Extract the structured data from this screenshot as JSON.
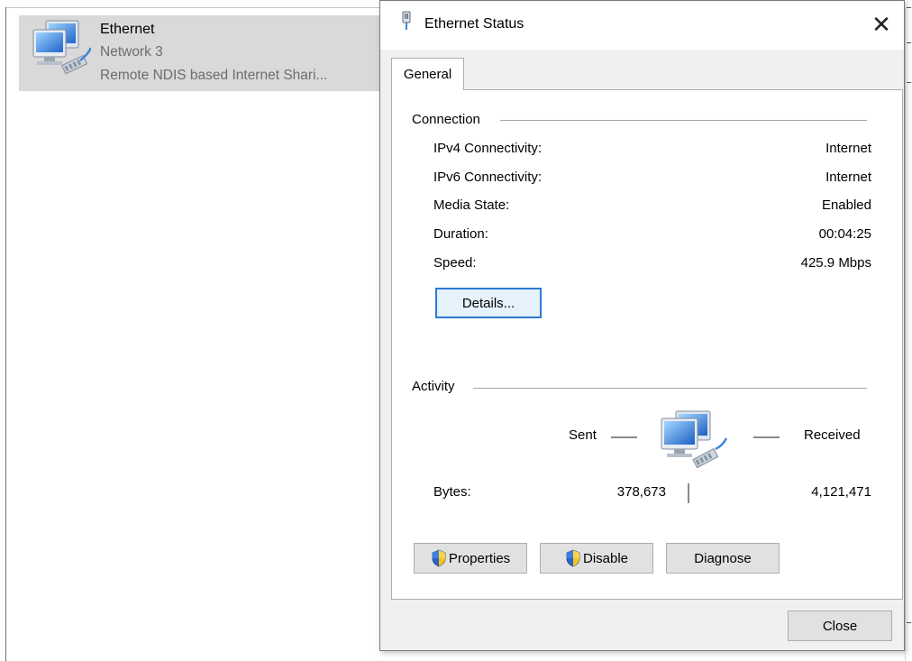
{
  "background_window": {
    "adapter": {
      "name": "Ethernet",
      "network": "Network 3",
      "device": "Remote NDIS based Internet Shari...",
      "icon": "network-adapter-icon"
    }
  },
  "dialog": {
    "title": "Ethernet Status",
    "close_glyph": "✕",
    "tabs": [
      "General"
    ],
    "connection": {
      "label": "Connection",
      "rows": [
        {
          "label": "IPv4 Connectivity:",
          "value": "Internet"
        },
        {
          "label": "IPv6 Connectivity:",
          "value": "Internet"
        },
        {
          "label": "Media State:",
          "value": "Enabled"
        },
        {
          "label": "Duration:",
          "value": "00:04:25"
        },
        {
          "label": "Speed:",
          "value": "425.9 Mbps"
        }
      ],
      "details_button": "Details..."
    },
    "activity": {
      "label": "Activity",
      "sent_label": "Sent",
      "received_label": "Received",
      "bytes_label": "Bytes:",
      "bytes_sent": "378,673",
      "bytes_received": "4,121,471"
    },
    "buttons": {
      "properties": "Properties",
      "disable": "Disable",
      "diagnose": "Diagnose",
      "close": "Close"
    },
    "colors": {
      "accent": "#2b7bd2",
      "selection": "#d9d9d9",
      "dialog_bg": "#f0f0f0"
    }
  }
}
